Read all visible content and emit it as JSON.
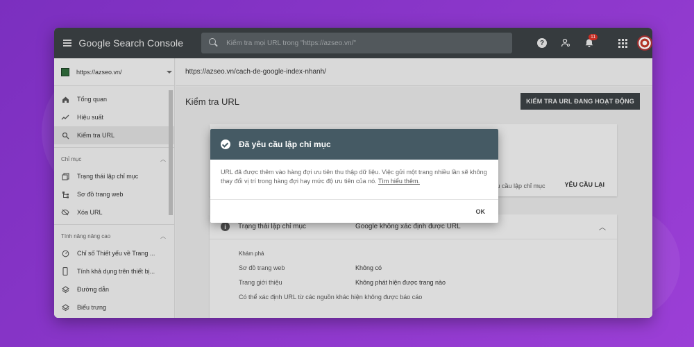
{
  "app": {
    "brand": "Google Search Console",
    "search_placeholder": "Kiểm tra mọi URL trong \"https://azseo.vn/\"",
    "notifications_count": "11"
  },
  "sidebar": {
    "property": "https://azseo.vn/",
    "items": [
      {
        "label": "Tổng quan",
        "icon": "home-icon"
      },
      {
        "label": "Hiệu suất",
        "icon": "trending-icon"
      },
      {
        "label": "Kiểm tra URL",
        "icon": "search-icon"
      }
    ],
    "section_index": "Chỉ mục",
    "index_items": [
      {
        "label": "Trạng thái lập chỉ mục",
        "icon": "pages-icon"
      },
      {
        "label": "Sơ đồ trang web",
        "icon": "sitemap-icon"
      },
      {
        "label": "Xóa URL",
        "icon": "eye-off-icon"
      }
    ],
    "section_advanced": "Tính năng nâng cao",
    "advanced_items": [
      {
        "label": "Chỉ số Thiết yếu về Trang ...",
        "icon": "gauge-icon"
      },
      {
        "label": "Tính khả dụng trên thiết bị...",
        "icon": "phone-icon"
      },
      {
        "label": "Đường dẫn",
        "icon": "layers-icon"
      },
      {
        "label": "Biểu trưng",
        "icon": "layers-icon"
      }
    ]
  },
  "main": {
    "url": "https://azseo.vn/cach-de-google-index-nhanh/",
    "title": "Kiểm tra URL",
    "live_button": "KIỂM TRA URL ĐANG HOẠT ĐỘNG",
    "request_text": "yêu cầu lập chỉ mục",
    "request_button": "YÊU CẦU LẠI",
    "coverage_label": "Trạng thái lập chỉ mục",
    "coverage_value": "Google không xác định được URL",
    "discovery_heading": "Khám phá",
    "sitemaps_label": "Sơ đồ trang web",
    "sitemaps_value": "Không có",
    "referring_label": "Trang giới thiệu",
    "referring_value": "Không phát hiện được trang nào",
    "note": "Có thể xác định URL từ các nguồn khác hiện không được báo cáo"
  },
  "dialog": {
    "title": "Đã yêu cầu lập chỉ mục",
    "body": "URL đã được thêm vào hàng đợi ưu tiên thu thập dữ liệu. Việc gửi một trang nhiều lần sẽ không thay đổi vị trí trong hàng đợi hay mức độ ưu tiên của nó.",
    "link": "Tìm hiểu thêm.",
    "ok": "OK"
  }
}
